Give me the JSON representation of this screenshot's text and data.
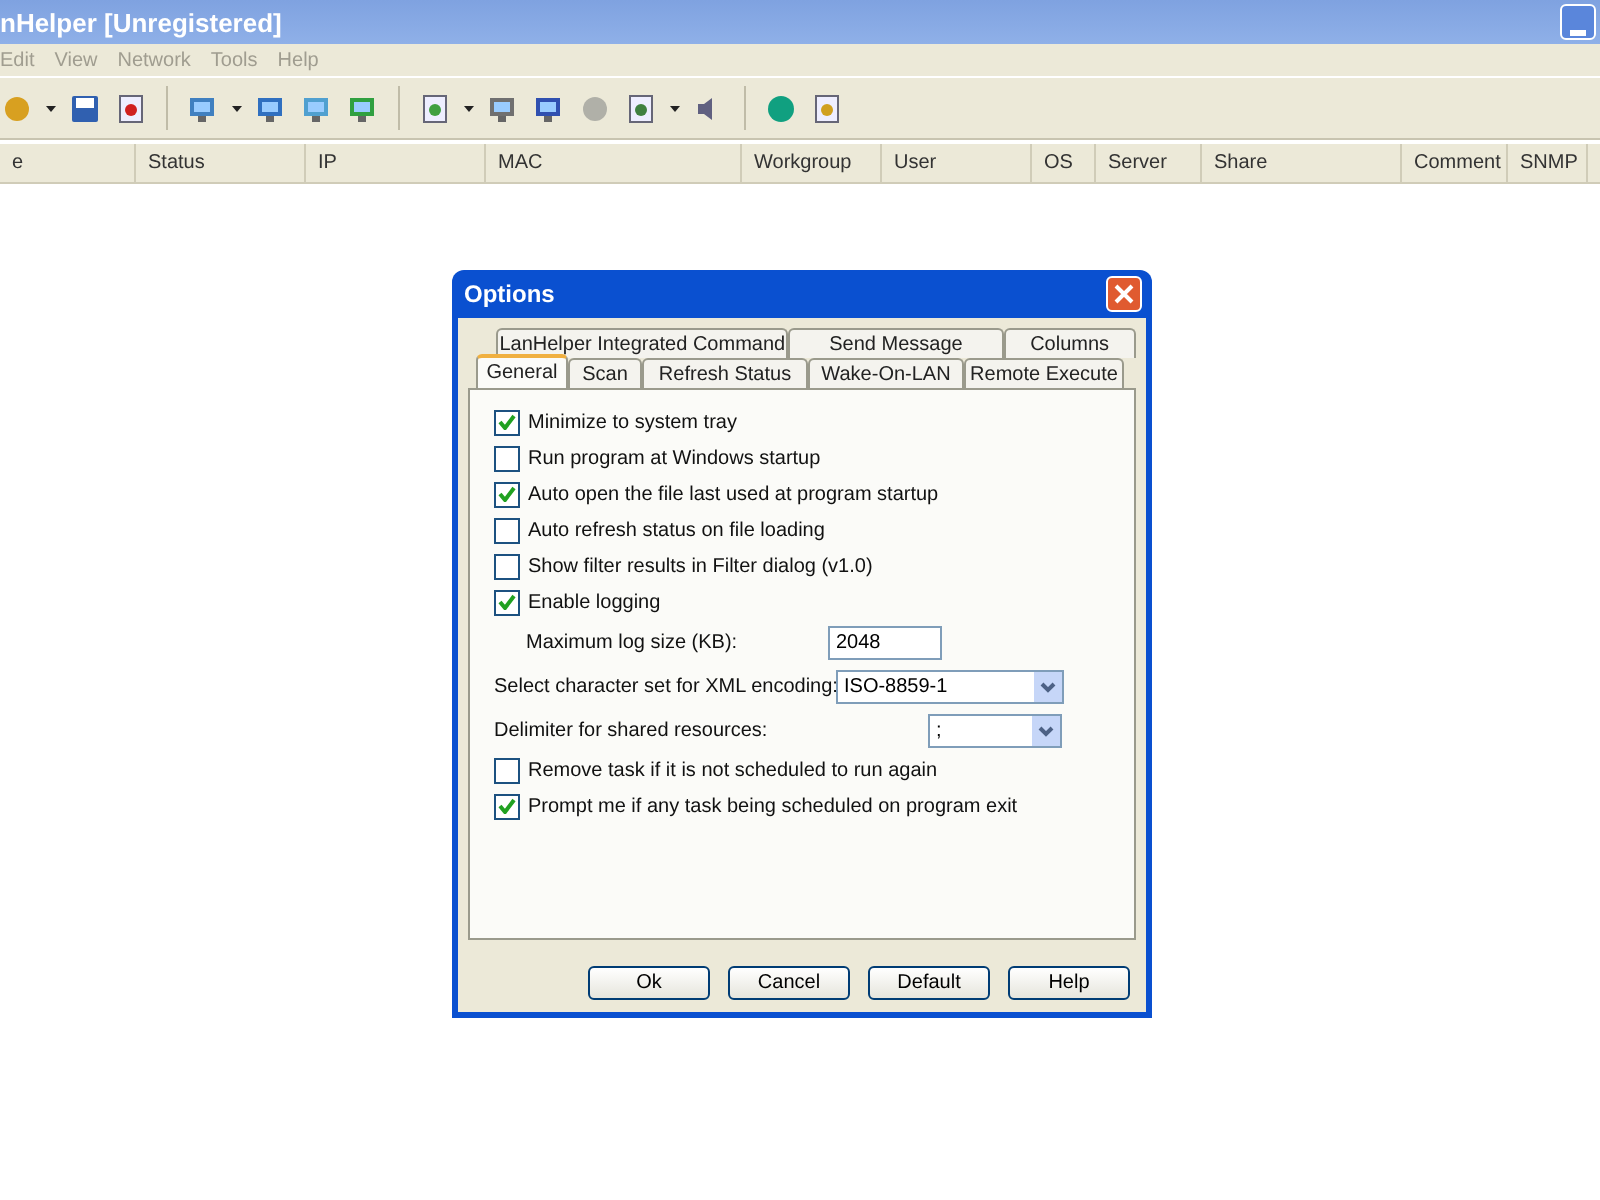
{
  "window": {
    "title": "nHelper [Unregistered]"
  },
  "menu": [
    "Edit",
    "View",
    "Network",
    "Tools",
    "Help"
  ],
  "columns": [
    "e",
    "Status",
    "IP",
    "MAC",
    "Workgroup",
    "User",
    "OS",
    "Server",
    "Share",
    "Comment",
    "SNMP"
  ],
  "dialog": {
    "title": "Options",
    "tab_rows": [
      [
        {
          "label": "LanHelper Integrated Command",
          "selected": false
        },
        {
          "label": "Send Message",
          "selected": false
        },
        {
          "label": "Columns",
          "selected": false
        }
      ],
      [
        {
          "label": "General",
          "selected": true
        },
        {
          "label": "Scan",
          "selected": false
        },
        {
          "label": "Refresh Status",
          "selected": false
        },
        {
          "label": "Wake-On-LAN",
          "selected": false
        },
        {
          "label": "Remote Execute",
          "selected": false
        }
      ]
    ],
    "items": [
      {
        "kind": "checkbox",
        "label": "Minimize to system tray",
        "checked": true
      },
      {
        "kind": "checkbox",
        "label": "Run program at Windows startup",
        "checked": false
      },
      {
        "kind": "checkbox",
        "label": "Auto open the file last used at program startup",
        "checked": true
      },
      {
        "kind": "checkbox",
        "label": "Auto refresh status on file loading",
        "checked": false
      },
      {
        "kind": "checkbox",
        "label": "Show filter results in Filter dialog (v1.0)",
        "checked": false
      },
      {
        "kind": "checkbox",
        "label": "Enable logging",
        "checked": true
      },
      {
        "kind": "text",
        "label": "Maximum log size (KB):",
        "value": "2048"
      },
      {
        "kind": "select",
        "label": "Select character set for XML encoding:",
        "value": "ISO-8859-1"
      },
      {
        "kind": "select_small",
        "label": "Delimiter for shared resources:",
        "value": ";"
      },
      {
        "kind": "checkbox",
        "label": "Remove task if it is not scheduled to run again",
        "checked": false
      },
      {
        "kind": "checkbox",
        "label": "Prompt me if any task being scheduled on program exit",
        "checked": true
      }
    ],
    "buttons": [
      "Ok",
      "Cancel",
      "Default",
      "Help"
    ]
  }
}
